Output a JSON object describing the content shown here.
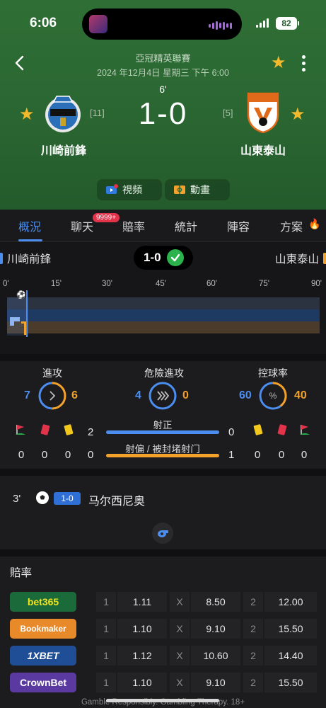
{
  "status_bar": {
    "time": "6:06",
    "battery": "82"
  },
  "header": {
    "league": "亞冠精英聯賽",
    "datetime": "2024 年12月4日 星期三 下午 6:00",
    "minute": "6'",
    "score": "1-0",
    "home": {
      "name": "川崎前鋒",
      "rank": "[11]"
    },
    "away": {
      "name": "山東泰山",
      "rank": "[5]"
    },
    "video_label": "視頻",
    "animation_label": "動畫"
  },
  "tabs": {
    "items": [
      "概況",
      "聊天",
      "賠率",
      "統計",
      "陣容",
      "方案"
    ],
    "active": "概況",
    "chat_badge": "9999+"
  },
  "match_bar": {
    "home": "川崎前鋒",
    "away": "山東泰山",
    "score": "1-0"
  },
  "timeline": {
    "ticks": [
      "0'",
      "15'",
      "30'",
      "45'",
      "60'",
      "75'",
      "90'"
    ],
    "current_minute": 6
  },
  "stats": {
    "attacks": {
      "label": "進攻",
      "home": "7",
      "away": "6"
    },
    "dangerous": {
      "label": "危險進攻",
      "home": "4",
      "away": "0"
    },
    "possession": {
      "label": "控球率",
      "home": "60",
      "away": "40"
    },
    "home_cards": [
      "0",
      "0",
      "0"
    ],
    "away_cards": [
      "0",
      "0",
      "0"
    ],
    "shots_on": {
      "label": "射正",
      "home": "2",
      "away": "0"
    },
    "shots_off": {
      "label": "射偏 / 被封堵射门",
      "home": "0",
      "away": "1"
    }
  },
  "events": [
    {
      "minute": "3'",
      "score": "1-0",
      "player": "马尔西尼奥"
    }
  ],
  "odds": {
    "title": "賠率",
    "rows": [
      {
        "bookmaker": "bet365",
        "color": "#1b6b3a",
        "text": "#f2e31c",
        "v1": "1.11",
        "vx": "8.50",
        "v2": "12.00"
      },
      {
        "bookmaker": "Bookmaker",
        "color": "#e8892a",
        "text": "#ffffff",
        "v1": "1.10",
        "vx": "9.10",
        "v2": "15.50"
      },
      {
        "bookmaker": "1XBET",
        "color": "#1f4d96",
        "text": "#ffffff",
        "v1": "1.12",
        "vx": "10.60",
        "v2": "14.40"
      },
      {
        "bookmaker": "CrownBet",
        "color": "#5a3aa0",
        "text": "#ffffff",
        "v1": "1.10",
        "vx": "9.10",
        "v2": "15.50"
      }
    ],
    "col_labels": [
      "1",
      "X",
      "2"
    ]
  },
  "footer": "Gamble Responsibly. Gambling Therapy. 18+"
}
